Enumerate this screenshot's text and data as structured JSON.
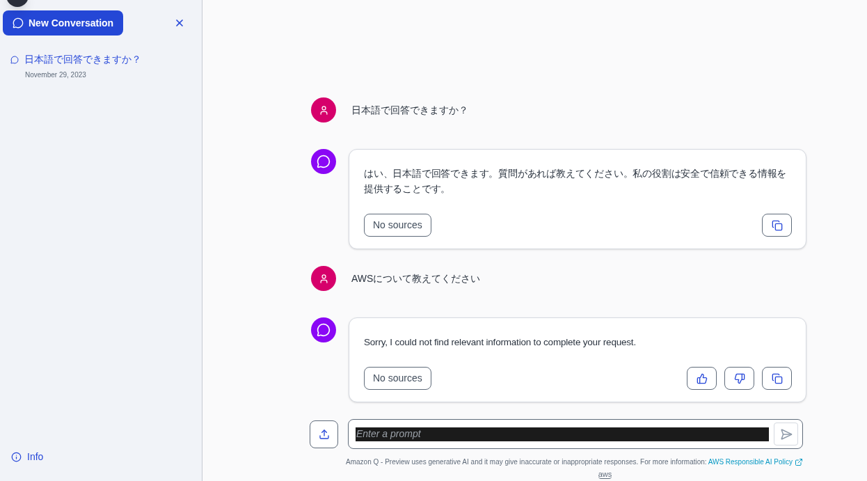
{
  "sidebar": {
    "new_button": "New Conversation",
    "history": [
      {
        "title": "日本語で回答できますか？",
        "date": "November 29, 2023",
        "selected": true
      }
    ],
    "info_link": "Info"
  },
  "messages": [
    {
      "kind": "user",
      "text": "日本語で回答できますか？"
    },
    {
      "kind": "assistant",
      "text": "はい、日本語で回答できます。質問があれば教えてください。私の役割は安全で信頼できる情報を提供することです。",
      "sources": "No sources",
      "actions": [
        {
          "kind": "copy"
        }
      ]
    },
    {
      "kind": "user",
      "text": "AWSについて教えてください"
    },
    {
      "kind": "assistant",
      "text": "Sorry, I could not find relevant information to complete your request.",
      "sources": "No sources",
      "actions": [
        {
          "kind": "thumbs-up"
        },
        {
          "kind": "thumbs-down"
        },
        {
          "kind": "copy"
        }
      ]
    }
  ],
  "prompt": {
    "placeholder": "Enter a prompt"
  },
  "footer": {
    "disclaimer": "Amazon Q - Preview uses generative AI and it may give inaccurate or inappropriate responses. For more information:",
    "link": "AWS Responsible AI Policy",
    "logo_text": "aws"
  }
}
